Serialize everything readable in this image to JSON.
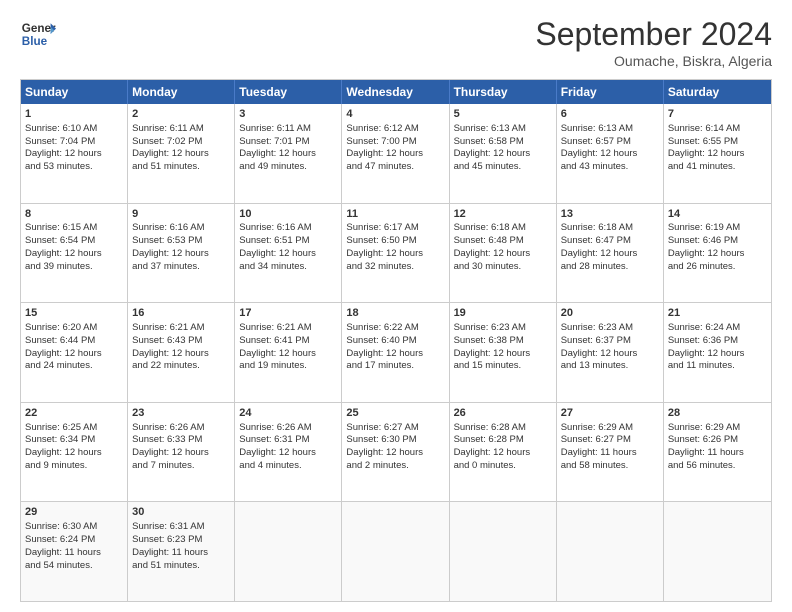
{
  "header": {
    "logo_line1": "General",
    "logo_line2": "Blue",
    "title": "September 2024",
    "subtitle": "Oumache, Biskra, Algeria"
  },
  "weekdays": [
    "Sunday",
    "Monday",
    "Tuesday",
    "Wednesday",
    "Thursday",
    "Friday",
    "Saturday"
  ],
  "rows": [
    [
      {
        "day": "1",
        "lines": [
          "Sunrise: 6:10 AM",
          "Sunset: 7:04 PM",
          "Daylight: 12 hours",
          "and 53 minutes."
        ]
      },
      {
        "day": "2",
        "lines": [
          "Sunrise: 6:11 AM",
          "Sunset: 7:02 PM",
          "Daylight: 12 hours",
          "and 51 minutes."
        ]
      },
      {
        "day": "3",
        "lines": [
          "Sunrise: 6:11 AM",
          "Sunset: 7:01 PM",
          "Daylight: 12 hours",
          "and 49 minutes."
        ]
      },
      {
        "day": "4",
        "lines": [
          "Sunrise: 6:12 AM",
          "Sunset: 7:00 PM",
          "Daylight: 12 hours",
          "and 47 minutes."
        ]
      },
      {
        "day": "5",
        "lines": [
          "Sunrise: 6:13 AM",
          "Sunset: 6:58 PM",
          "Daylight: 12 hours",
          "and 45 minutes."
        ]
      },
      {
        "day": "6",
        "lines": [
          "Sunrise: 6:13 AM",
          "Sunset: 6:57 PM",
          "Daylight: 12 hours",
          "and 43 minutes."
        ]
      },
      {
        "day": "7",
        "lines": [
          "Sunrise: 6:14 AM",
          "Sunset: 6:55 PM",
          "Daylight: 12 hours",
          "and 41 minutes."
        ]
      }
    ],
    [
      {
        "day": "8",
        "lines": [
          "Sunrise: 6:15 AM",
          "Sunset: 6:54 PM",
          "Daylight: 12 hours",
          "and 39 minutes."
        ]
      },
      {
        "day": "9",
        "lines": [
          "Sunrise: 6:16 AM",
          "Sunset: 6:53 PM",
          "Daylight: 12 hours",
          "and 37 minutes."
        ]
      },
      {
        "day": "10",
        "lines": [
          "Sunrise: 6:16 AM",
          "Sunset: 6:51 PM",
          "Daylight: 12 hours",
          "and 34 minutes."
        ]
      },
      {
        "day": "11",
        "lines": [
          "Sunrise: 6:17 AM",
          "Sunset: 6:50 PM",
          "Daylight: 12 hours",
          "and 32 minutes."
        ]
      },
      {
        "day": "12",
        "lines": [
          "Sunrise: 6:18 AM",
          "Sunset: 6:48 PM",
          "Daylight: 12 hours",
          "and 30 minutes."
        ]
      },
      {
        "day": "13",
        "lines": [
          "Sunrise: 6:18 AM",
          "Sunset: 6:47 PM",
          "Daylight: 12 hours",
          "and 28 minutes."
        ]
      },
      {
        "day": "14",
        "lines": [
          "Sunrise: 6:19 AM",
          "Sunset: 6:46 PM",
          "Daylight: 12 hours",
          "and 26 minutes."
        ]
      }
    ],
    [
      {
        "day": "15",
        "lines": [
          "Sunrise: 6:20 AM",
          "Sunset: 6:44 PM",
          "Daylight: 12 hours",
          "and 24 minutes."
        ]
      },
      {
        "day": "16",
        "lines": [
          "Sunrise: 6:21 AM",
          "Sunset: 6:43 PM",
          "Daylight: 12 hours",
          "and 22 minutes."
        ]
      },
      {
        "day": "17",
        "lines": [
          "Sunrise: 6:21 AM",
          "Sunset: 6:41 PM",
          "Daylight: 12 hours",
          "and 19 minutes."
        ]
      },
      {
        "day": "18",
        "lines": [
          "Sunrise: 6:22 AM",
          "Sunset: 6:40 PM",
          "Daylight: 12 hours",
          "and 17 minutes."
        ]
      },
      {
        "day": "19",
        "lines": [
          "Sunrise: 6:23 AM",
          "Sunset: 6:38 PM",
          "Daylight: 12 hours",
          "and 15 minutes."
        ]
      },
      {
        "day": "20",
        "lines": [
          "Sunrise: 6:23 AM",
          "Sunset: 6:37 PM",
          "Daylight: 12 hours",
          "and 13 minutes."
        ]
      },
      {
        "day": "21",
        "lines": [
          "Sunrise: 6:24 AM",
          "Sunset: 6:36 PM",
          "Daylight: 12 hours",
          "and 11 minutes."
        ]
      }
    ],
    [
      {
        "day": "22",
        "lines": [
          "Sunrise: 6:25 AM",
          "Sunset: 6:34 PM",
          "Daylight: 12 hours",
          "and 9 minutes."
        ]
      },
      {
        "day": "23",
        "lines": [
          "Sunrise: 6:26 AM",
          "Sunset: 6:33 PM",
          "Daylight: 12 hours",
          "and 7 minutes."
        ]
      },
      {
        "day": "24",
        "lines": [
          "Sunrise: 6:26 AM",
          "Sunset: 6:31 PM",
          "Daylight: 12 hours",
          "and 4 minutes."
        ]
      },
      {
        "day": "25",
        "lines": [
          "Sunrise: 6:27 AM",
          "Sunset: 6:30 PM",
          "Daylight: 12 hours",
          "and 2 minutes."
        ]
      },
      {
        "day": "26",
        "lines": [
          "Sunrise: 6:28 AM",
          "Sunset: 6:28 PM",
          "Daylight: 12 hours",
          "and 0 minutes."
        ]
      },
      {
        "day": "27",
        "lines": [
          "Sunrise: 6:29 AM",
          "Sunset: 6:27 PM",
          "Daylight: 11 hours",
          "and 58 minutes."
        ]
      },
      {
        "day": "28",
        "lines": [
          "Sunrise: 6:29 AM",
          "Sunset: 6:26 PM",
          "Daylight: 11 hours",
          "and 56 minutes."
        ]
      }
    ],
    [
      {
        "day": "29",
        "lines": [
          "Sunrise: 6:30 AM",
          "Sunset: 6:24 PM",
          "Daylight: 11 hours",
          "and 54 minutes."
        ]
      },
      {
        "day": "30",
        "lines": [
          "Sunrise: 6:31 AM",
          "Sunset: 6:23 PM",
          "Daylight: 11 hours",
          "and 51 minutes."
        ]
      },
      {
        "day": "",
        "lines": []
      },
      {
        "day": "",
        "lines": []
      },
      {
        "day": "",
        "lines": []
      },
      {
        "day": "",
        "lines": []
      },
      {
        "day": "",
        "lines": []
      }
    ]
  ]
}
